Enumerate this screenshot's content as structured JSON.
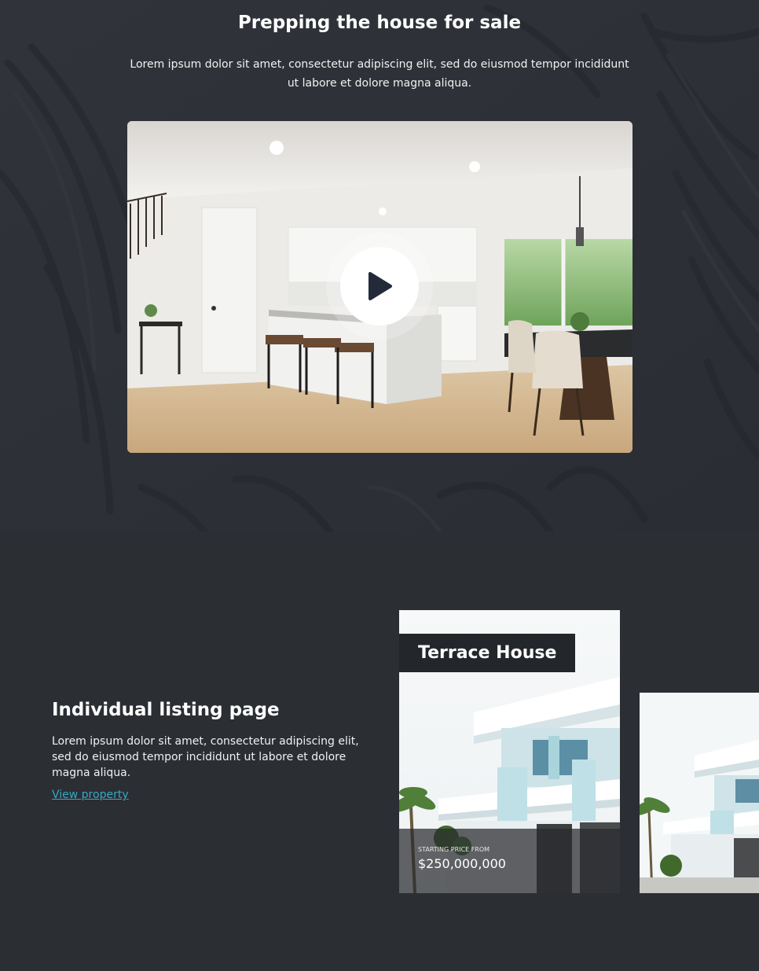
{
  "video_section": {
    "title": "Prepping the house for sale",
    "description": "Lorem ipsum dolor sit amet, consectetur adipiscing elit, sed do eiusmod tempor incididunt ut labore et dolore magna aliqua.",
    "play_icon": "play-icon"
  },
  "listing_section": {
    "title": "Individual listing page",
    "description": "Lorem ipsum dolor sit amet, consectetur adipiscing elit, sed do eiusmod tempor incididunt ut labore et dolore magna aliqua.",
    "link_label": "View property",
    "link_color": "#39a8c4",
    "cards": [
      {
        "name": "Terrace House",
        "price_caption": "STARTING PRICE FROM",
        "price": "$250,000,000"
      }
    ]
  }
}
